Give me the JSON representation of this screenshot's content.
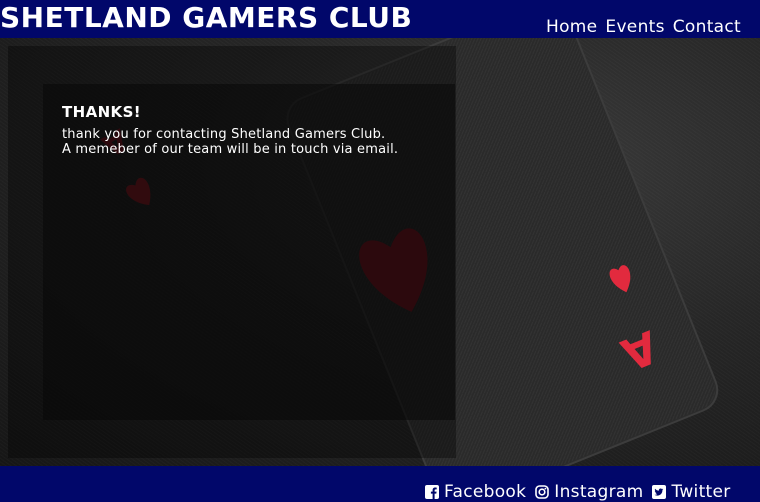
{
  "header": {
    "title": "SHETLAND GAMERS CLUB",
    "nav": [
      {
        "label": "Home"
      },
      {
        "label": "Events"
      },
      {
        "label": "Contact"
      }
    ]
  },
  "main": {
    "heading": "THANKS!",
    "message_line1": "thank you for contacting Shetland Gamers Club.",
    "message_line2": "A memeber of our team will be in touch via email."
  },
  "footer": {
    "social": [
      {
        "label": "Facebook",
        "icon": "facebook-icon"
      },
      {
        "label": "Instagram",
        "icon": "instagram-icon"
      },
      {
        "label": "Twitter",
        "icon": "twitter-icon"
      }
    ]
  },
  "colors": {
    "header_bg": "#01076a",
    "footer_bg": "#01076a",
    "text": "#ffffff",
    "heart_red": "#d81e35"
  }
}
